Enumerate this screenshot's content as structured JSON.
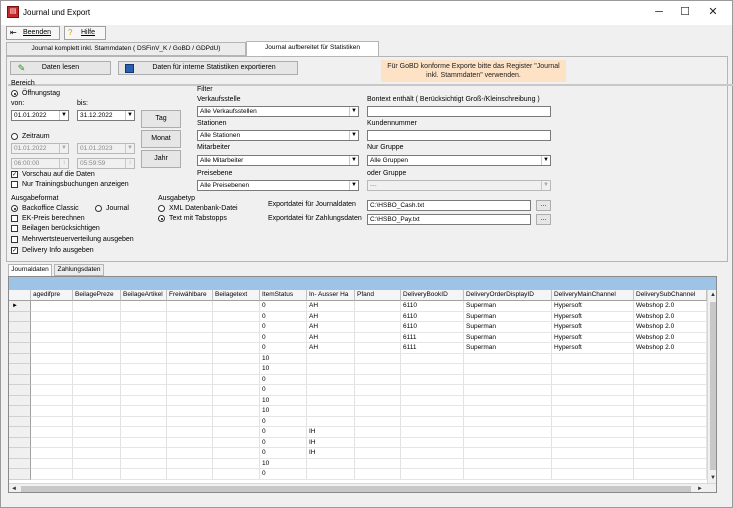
{
  "window": {
    "title": "Journal und Export",
    "minimize": "─",
    "maximize": "☐",
    "close": "✕"
  },
  "menubar": {
    "exit_label": "Beenden",
    "help_label": "Hilfe",
    "exit_accel": "B",
    "help_accel": "H"
  },
  "tabs": [
    {
      "label": "Journal komplett inkl. Stammdaten ( DSFinV_K / GoBD / GDPdU)"
    },
    {
      "label": "Journal aufbereitet für Statistiken"
    }
  ],
  "toolbar": {
    "read_data_label": "Daten lesen",
    "export_stats_label": "Daten für interne Statistiken exportieren",
    "info_text_line1": "Für GoBD konforme Exporte bitte das Register \"Journal",
    "info_text_line2": "inkl. Stammdaten\" verwenden."
  },
  "bereich": {
    "group_label": "Bereich",
    "opening_day_label": "Öffnungstag",
    "from_label": "von:",
    "to_label": "bis:",
    "from_date": "01.01.2022",
    "to_date": "31.12.2022",
    "day_button": "Tag",
    "month_button": "Monat",
    "year_button": "Jahr",
    "period_label": "Zeitraum",
    "period_from_date": "01.01.2022",
    "period_to_date": "01.01.2023",
    "period_from_time": "06:00:00",
    "period_to_time": "05:59:59",
    "preview_label": "Vorschau auf die Daten",
    "training_label": "Nur Trainingsbuchungen anzeigen"
  },
  "filter": {
    "group_label": "Filter",
    "sales_point_label": "Verkaufsstelle",
    "sales_point_value": "Alle Verkaufsstellen",
    "stations_label": "Stationen",
    "stations_value": "Alle Stationen",
    "staff_label": "Mitarbeiter",
    "staff_value": "Alle Mitarbeiter",
    "price_level_label": "Preisebene",
    "price_level_value": "Alle Preisebenen",
    "receipt_text_label": "Bontext enthält ( Berücksichtigt Groß-/Kleinschreibung )",
    "receipt_text_value": "",
    "customer_number_label": "Kundennummer",
    "customer_number_value": "",
    "group_only_label": "Nur Gruppe",
    "group_only_value": "Alle Gruppen",
    "or_group_label": "oder Gruppe",
    "or_group_value": "---"
  },
  "ausgabeformat": {
    "label": "Ausgabeformat",
    "backoffice_label": "Backoffice Classic",
    "journal_label": "Journal",
    "ek_price_label": "EK-Preis berechnen",
    "supplements_label": "Beilagen berücksichtigen",
    "vat_split_label": "Mehrwertsteuerverteilung ausgeben",
    "delivery_info_label": "Delivery Info ausgeben"
  },
  "ausgabetyp": {
    "label": "Ausgabetyp",
    "xml_label": "XML Datenbank-Datei",
    "text_tabs_label": "Text mit Tabstopps"
  },
  "export": {
    "journal_file_label": "Exportdatei für Journaldaten",
    "journal_file_value": "C:\\HSBO_Cash.txt",
    "payment_file_label": "Exportdatei für Zahlungsdaten",
    "payment_file_value": "C:\\HSBO_Pay.txt",
    "browse_label": "..."
  },
  "bottom_tabs": [
    {
      "label": "Journaldaten"
    },
    {
      "label": "Zahlungsdaten"
    }
  ],
  "grid": {
    "columns": [
      "agedifpre",
      "BeilagePreze",
      "BeilageArtikel",
      "Freiwählbare",
      "Beilagetext",
      "ItemStatus",
      "In- Ausser Ha",
      "Pfand",
      "DeliveryBookID",
      "DeliveryOrderDisplayID",
      "DeliveryMainChannel",
      "DeliverySubChannel"
    ],
    "rows": [
      [
        "",
        "",
        "",
        "",
        "",
        "0",
        "AH",
        "",
        "6110",
        "Superman",
        "Hypersoft",
        "Webshop 2.0"
      ],
      [
        "",
        "",
        "",
        "",
        "",
        "0",
        "AH",
        "",
        "6110",
        "Superman",
        "Hypersoft",
        "Webshop 2.0"
      ],
      [
        "",
        "",
        "",
        "",
        "",
        "0",
        "AH",
        "",
        "6110",
        "Superman",
        "Hypersoft",
        "Webshop 2.0"
      ],
      [
        "",
        "",
        "",
        "",
        "",
        "0",
        "AH",
        "",
        "6111",
        "Superman",
        "Hypersoft",
        "Webshop 2.0"
      ],
      [
        "",
        "",
        "",
        "",
        "",
        "0",
        "AH",
        "",
        "6111",
        "Superman",
        "Hypersoft",
        "Webshop 2.0"
      ],
      [
        "",
        "",
        "",
        "",
        "",
        "10",
        "",
        "",
        "",
        "",
        "",
        ""
      ],
      [
        "",
        "",
        "",
        "",
        "",
        "10",
        "",
        "",
        "",
        "",
        "",
        ""
      ],
      [
        "",
        "",
        "",
        "",
        "",
        "0",
        "",
        "",
        "",
        "",
        "",
        ""
      ],
      [
        "",
        "",
        "",
        "",
        "",
        "0",
        "",
        "",
        "",
        "",
        "",
        ""
      ],
      [
        "",
        "",
        "",
        "",
        "",
        "10",
        "",
        "",
        "",
        "",
        "",
        ""
      ],
      [
        "",
        "",
        "",
        "",
        "",
        "10",
        "",
        "",
        "",
        "",
        "",
        ""
      ],
      [
        "",
        "",
        "",
        "",
        "",
        "0",
        "",
        "",
        "",
        "",
        "",
        ""
      ],
      [
        "",
        "",
        "",
        "",
        "",
        "0",
        "IH",
        "",
        "",
        "",
        "",
        ""
      ],
      [
        "",
        "",
        "",
        "",
        "",
        "0",
        "IH",
        "",
        "",
        "",
        "",
        ""
      ],
      [
        "",
        "",
        "",
        "",
        "",
        "0",
        "IH",
        "",
        "",
        "",
        "",
        ""
      ],
      [
        "",
        "",
        "",
        "",
        "",
        "10",
        "",
        "",
        "",
        "",
        "",
        ""
      ],
      [
        "",
        "",
        "",
        "",
        "",
        "0",
        "",
        "",
        "",
        "",
        "",
        ""
      ]
    ],
    "current_row_marker": "►"
  },
  "scroll": {
    "up": "▲",
    "down": "▼",
    "left": "◄",
    "right": "►"
  }
}
